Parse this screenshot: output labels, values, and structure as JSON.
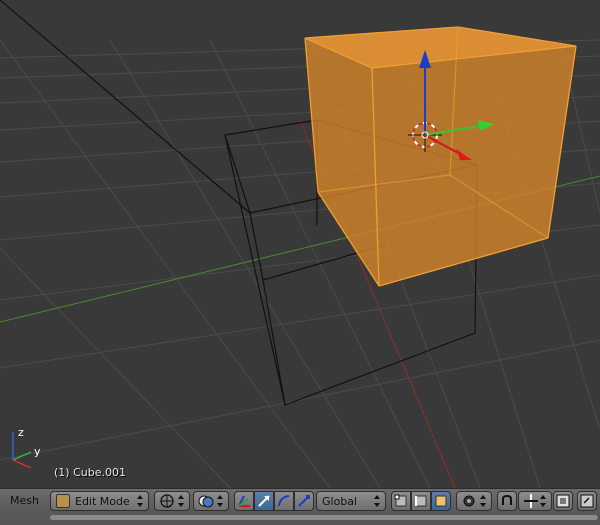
{
  "viewport": {
    "object_label": "(1) Cube.001",
    "axis_labels": {
      "z": "z",
      "y": "y"
    },
    "colors": {
      "background": "#393939",
      "grid": "#4a4a4a",
      "x_axis": "#8a2f2f",
      "y_axis": "#4b8a2a",
      "selection": "#f0a030",
      "selected_face": "#d9862a"
    }
  },
  "header": {
    "editor_menu_label": "Mesh",
    "mode_selector": {
      "value": "Edit Mode",
      "icon": "edit-mode-icon"
    },
    "pivot_icon": "pivot-point-icon",
    "shading_icon": "viewport-shading-icon",
    "manipulator_buttons": [
      {
        "icon": "manipulator-toggle-icon",
        "active": false
      },
      {
        "icon": "translate-manipulator-icon",
        "active": true
      },
      {
        "icon": "rotate-manipulator-icon",
        "active": false
      },
      {
        "icon": "scale-manipulator-icon",
        "active": false
      }
    ],
    "orientation": {
      "value": "Global"
    },
    "select_mode_buttons": [
      {
        "icon": "vertex-select-icon",
        "active": false
      },
      {
        "icon": "edge-select-icon",
        "active": false
      },
      {
        "icon": "face-select-icon",
        "active": true
      }
    ],
    "proportional_icon": "proportional-editing-icon",
    "right_icons": [
      "snap-icon",
      "snap-element-icon",
      "render-preview-icon",
      "expand-icon"
    ]
  }
}
